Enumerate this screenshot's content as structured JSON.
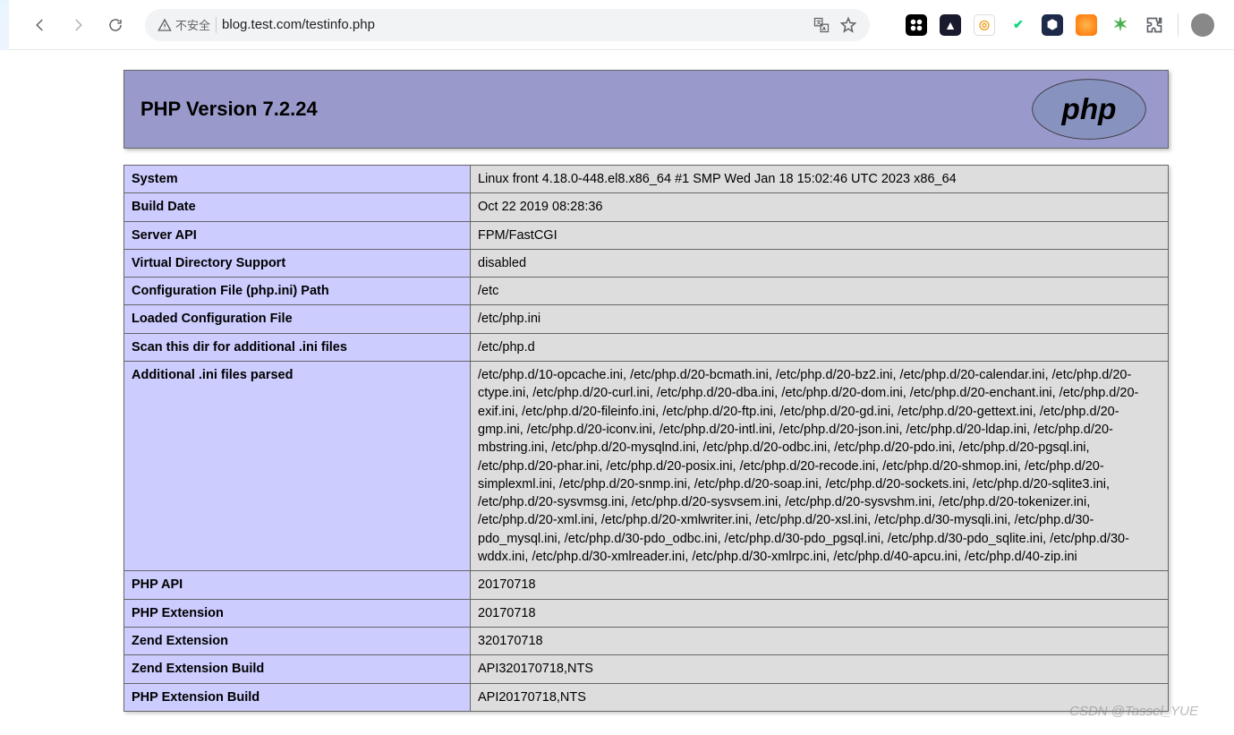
{
  "browser": {
    "security_label": "不安全",
    "url": "blog.test.com/testinfo.php"
  },
  "header": {
    "title": "PHP Version 7.2.24"
  },
  "info_rows": [
    {
      "k": "System",
      "v": "Linux front 4.18.0-448.el8.x86_64 #1 SMP Wed Jan 18 15:02:46 UTC 2023 x86_64"
    },
    {
      "k": "Build Date",
      "v": "Oct 22 2019 08:28:36"
    },
    {
      "k": "Server API",
      "v": "FPM/FastCGI"
    },
    {
      "k": "Virtual Directory Support",
      "v": "disabled"
    },
    {
      "k": "Configuration File (php.ini) Path",
      "v": "/etc"
    },
    {
      "k": "Loaded Configuration File",
      "v": "/etc/php.ini"
    },
    {
      "k": "Scan this dir for additional .ini files",
      "v": "/etc/php.d"
    },
    {
      "k": "Additional .ini files parsed",
      "v": "/etc/php.d/10-opcache.ini, /etc/php.d/20-bcmath.ini, /etc/php.d/20-bz2.ini, /etc/php.d/20-calendar.ini, /etc/php.d/20-ctype.ini, /etc/php.d/20-curl.ini, /etc/php.d/20-dba.ini, /etc/php.d/20-dom.ini, /etc/php.d/20-enchant.ini, /etc/php.d/20-exif.ini, /etc/php.d/20-fileinfo.ini, /etc/php.d/20-ftp.ini, /etc/php.d/20-gd.ini, /etc/php.d/20-gettext.ini, /etc/php.d/20-gmp.ini, /etc/php.d/20-iconv.ini, /etc/php.d/20-intl.ini, /etc/php.d/20-json.ini, /etc/php.d/20-ldap.ini, /etc/php.d/20-mbstring.ini, /etc/php.d/20-mysqlnd.ini, /etc/php.d/20-odbc.ini, /etc/php.d/20-pdo.ini, /etc/php.d/20-pgsql.ini, /etc/php.d/20-phar.ini, /etc/php.d/20-posix.ini, /etc/php.d/20-recode.ini, /etc/php.d/20-shmop.ini, /etc/php.d/20-simplexml.ini, /etc/php.d/20-snmp.ini, /etc/php.d/20-soap.ini, /etc/php.d/20-sockets.ini, /etc/php.d/20-sqlite3.ini, /etc/php.d/20-sysvmsg.ini, /etc/php.d/20-sysvsem.ini, /etc/php.d/20-sysvshm.ini, /etc/php.d/20-tokenizer.ini, /etc/php.d/20-xml.ini, /etc/php.d/20-xmlwriter.ini, /etc/php.d/20-xsl.ini, /etc/php.d/30-mysqli.ini, /etc/php.d/30-pdo_mysql.ini, /etc/php.d/30-pdo_odbc.ini, /etc/php.d/30-pdo_pgsql.ini, /etc/php.d/30-pdo_sqlite.ini, /etc/php.d/30-wddx.ini, /etc/php.d/30-xmlreader.ini, /etc/php.d/30-xmlrpc.ini, /etc/php.d/40-apcu.ini, /etc/php.d/40-zip.ini"
    },
    {
      "k": "PHP API",
      "v": "20170718"
    },
    {
      "k": "PHP Extension",
      "v": "20170718"
    },
    {
      "k": "Zend Extension",
      "v": "320170718"
    },
    {
      "k": "Zend Extension Build",
      "v": "API320170718,NTS"
    },
    {
      "k": "PHP Extension Build",
      "v": "API20170718,NTS"
    }
  ],
  "watermark": "CSDN @Tassel_YUE"
}
